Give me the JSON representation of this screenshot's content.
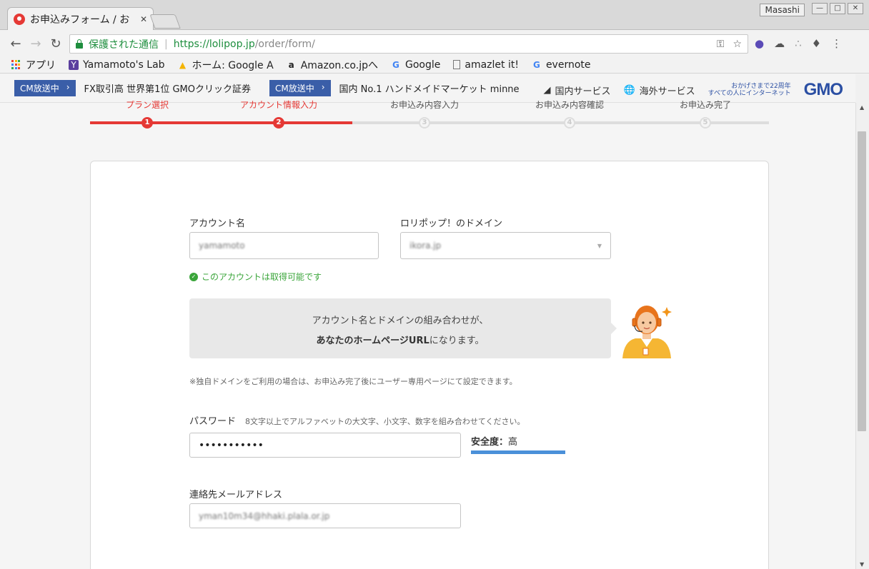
{
  "window": {
    "tab_title": "お申込みフォーム / お",
    "tab_close": "✕",
    "user": "Masashi",
    "controls": [
      "—",
      "□",
      "✕"
    ]
  },
  "toolbar": {
    "secure_label": "保護された通信",
    "url_scheme_host": "https://lolipop.jp",
    "url_path": "/order/form/"
  },
  "bookmarks": [
    {
      "label": "アプリ",
      "icon": "apps-grid-icon"
    },
    {
      "label": "Yamamoto's Lab",
      "icon": "y-icon"
    },
    {
      "label": "ホーム: Google A",
      "icon": "google-ads-icon"
    },
    {
      "label": "Amazon.co.jpへ",
      "icon": "amazon-icon"
    },
    {
      "label": "Google",
      "icon": "google-icon"
    },
    {
      "label": "amazlet it!",
      "icon": "page-icon"
    },
    {
      "label": "evernote",
      "icon": "google-icon"
    }
  ],
  "gmo_bar": {
    "cm_badge": "CM放送中",
    "ad1": "FX取引高 世界第1位 GMOクリック証券",
    "ad2": "国内 No.1 ハンドメイドマーケット minne",
    "domestic": "国内サービス",
    "overseas": "海外サービス",
    "tagline1": "おかげさまで22周年",
    "tagline2": "すべての人にインターネット",
    "logo": "GMO"
  },
  "steps": [
    {
      "label": "プラン選択",
      "num": "1",
      "active": true
    },
    {
      "label": "アカウント情報入力",
      "num": "2",
      "active": true
    },
    {
      "label": "お申込み内容入力",
      "num": "3",
      "active": false
    },
    {
      "label": "お申込み内容確認",
      "num": "4",
      "active": false
    },
    {
      "label": "お申込み完了",
      "num": "5",
      "active": false
    }
  ],
  "form": {
    "account_label": "アカウント名",
    "account_value": "yamamoto",
    "domain_label": "ロリポップ！のドメイン",
    "domain_value": "ikora.jp",
    "available_msg": "このアカウントは取得可能です",
    "bubble_line1": "アカウント名とドメインの組み合わせが、",
    "bubble_line2_bold": "あなたのホームページURL",
    "bubble_line2_rest": "になります。",
    "domain_note": "※独自ドメインをご利用の場合は、お申込み完了後にユーザー専用ページにて設定できます。",
    "password_label": "パスワード",
    "password_hint": "8文字以上でアルファベットの大文字、小文字、数字を組み合わせてください。",
    "password_value": "•••••••••••",
    "strength_label": "安全度：",
    "strength_value": "高",
    "email_label": "連絡先メールアドレス",
    "email_value": "yman10m34@hhaki.plala.or.jp"
  },
  "colors": {
    "accent_red": "#e53935",
    "gmo_blue": "#2b4fa3",
    "ok_green": "#3aa53a",
    "strength_blue": "#4a90d9"
  }
}
